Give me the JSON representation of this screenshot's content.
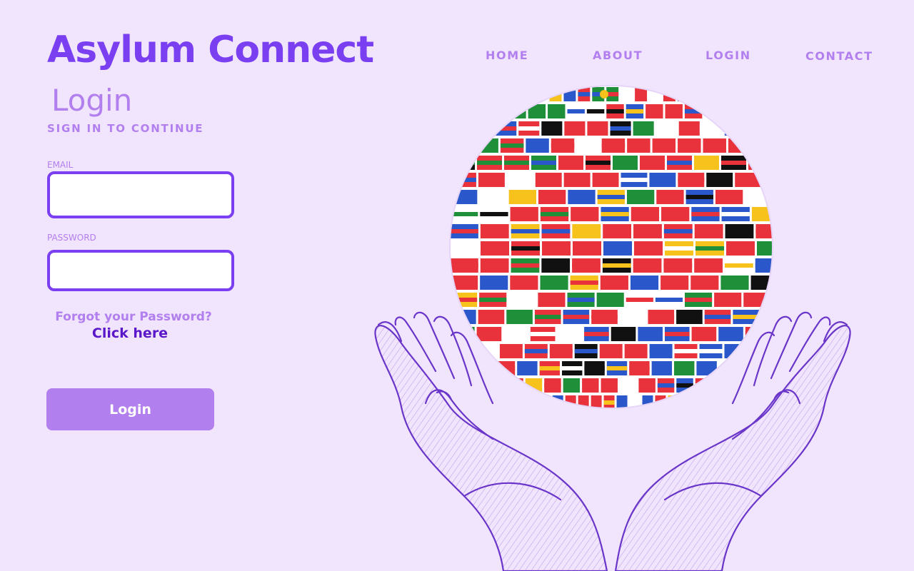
{
  "brand": {
    "title": "Asylum Connect"
  },
  "nav": {
    "items": [
      {
        "label": "HOME"
      },
      {
        "label": "ABOUT"
      },
      {
        "label": "LOGIN"
      },
      {
        "label": "CONTACT"
      }
    ]
  },
  "login": {
    "heading": "Login",
    "subtitle": "SIGN IN TO CONTINUE",
    "email_label": "EMAIL",
    "email_value": "",
    "password_label": "PASSWORD",
    "password_value": "",
    "forgot_text": "Forgot your Password?",
    "click_here": "Click here",
    "button_label": "Login"
  },
  "illustration": {
    "icon": "hands-holding-flag-globe-icon"
  },
  "colors": {
    "background": "#f1e4fd",
    "brand": "#7a3ff0",
    "muted": "#b27fee",
    "link": "#5a17c9",
    "button": "#b27fee",
    "hands_stroke": "#6a35c9"
  }
}
